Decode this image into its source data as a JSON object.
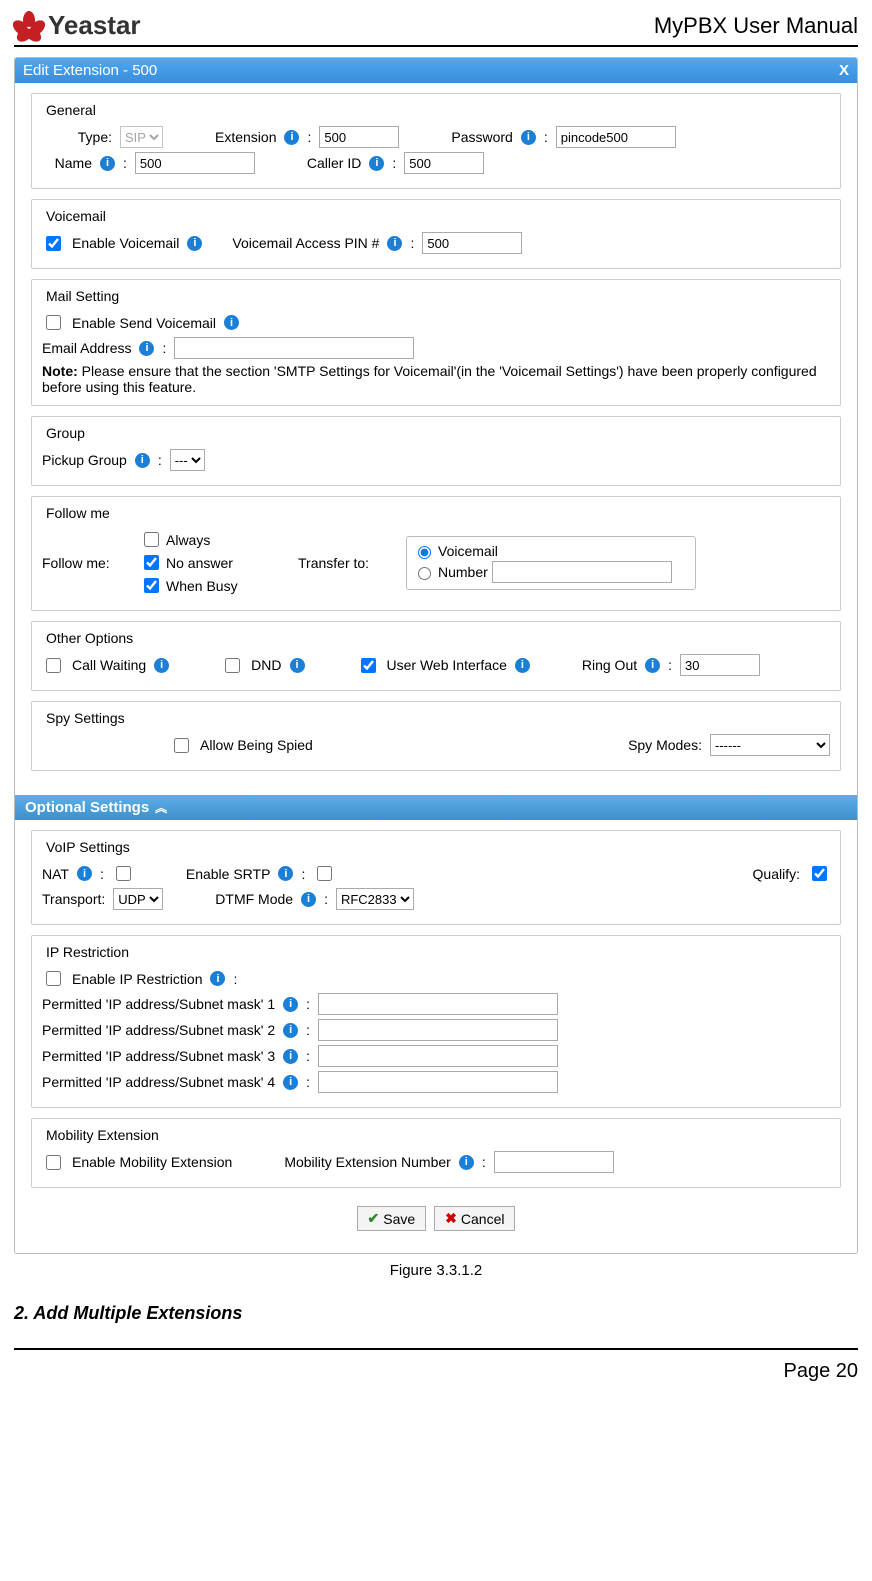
{
  "header": {
    "brand": "Yeastar",
    "doc_title": "MyPBX User Manual"
  },
  "dialog": {
    "title": "Edit Extension - 500",
    "close": "X"
  },
  "general": {
    "legend": "General",
    "type_label": "Type:",
    "type_value": "SIP",
    "extension_label": "Extension",
    "extension_value": "500",
    "password_label": "Password",
    "password_value": "pincode500",
    "name_label": "Name",
    "name_value": "500",
    "callerid_label": "Caller ID",
    "callerid_value": "500"
  },
  "voicemail": {
    "legend": "Voicemail",
    "enable_label": "Enable Voicemail",
    "pin_label": "Voicemail Access PIN #",
    "pin_value": "500"
  },
  "mail_setting": {
    "legend": "Mail Setting",
    "enable_label": "Enable Send Voicemail",
    "email_label": "Email Address",
    "note_prefix": "Note:",
    "note_text": " Please ensure that the section 'SMTP Settings for Voicemail'(in the 'Voicemail Settings') have been properly configured before using this feature."
  },
  "group": {
    "legend": "Group",
    "pickup_label": "Pickup Group",
    "pickup_value": "---"
  },
  "follow_me": {
    "legend": "Follow me",
    "row_label": "Follow me:",
    "always": "Always",
    "no_answer": "No answer",
    "when_busy": "When Busy",
    "transfer_label": "Transfer to:",
    "voicemail": "Voicemail",
    "number": "Number"
  },
  "other_options": {
    "legend": "Other Options",
    "call_waiting": "Call Waiting",
    "dnd": "DND",
    "user_web": "User Web Interface",
    "ring_out_label": "Ring Out",
    "ring_out_value": "30"
  },
  "spy": {
    "legend": "Spy Settings",
    "allow_label": "Allow Being Spied",
    "modes_label": "Spy Modes:",
    "modes_value": "------"
  },
  "optional_header": "Optional Settings",
  "voip": {
    "legend": "VoIP Settings",
    "nat_label": "NAT",
    "srtp_label": "Enable SRTP",
    "qualify_label": "Qualify:",
    "transport_label": "Transport:",
    "transport_value": "UDP",
    "dtmf_label": "DTMF Mode",
    "dtmf_value": "RFC2833"
  },
  "ip_restriction": {
    "legend": "IP Restriction",
    "enable_label": "Enable IP Restriction",
    "permitted_prefix": "Permitted 'IP address/Subnet mask' ",
    "n1": "1",
    "n2": "2",
    "n3": "3",
    "n4": "4"
  },
  "mobility": {
    "legend": "Mobility Extension",
    "enable_label": "Enable Mobility Extension",
    "number_label": "Mobility Extension Number"
  },
  "buttons": {
    "save": "Save",
    "cancel": "Cancel"
  },
  "figure_caption": "Figure 3.3.1.2",
  "section_heading": "2. Add Multiple Extensions",
  "page_number": "Page 20"
}
